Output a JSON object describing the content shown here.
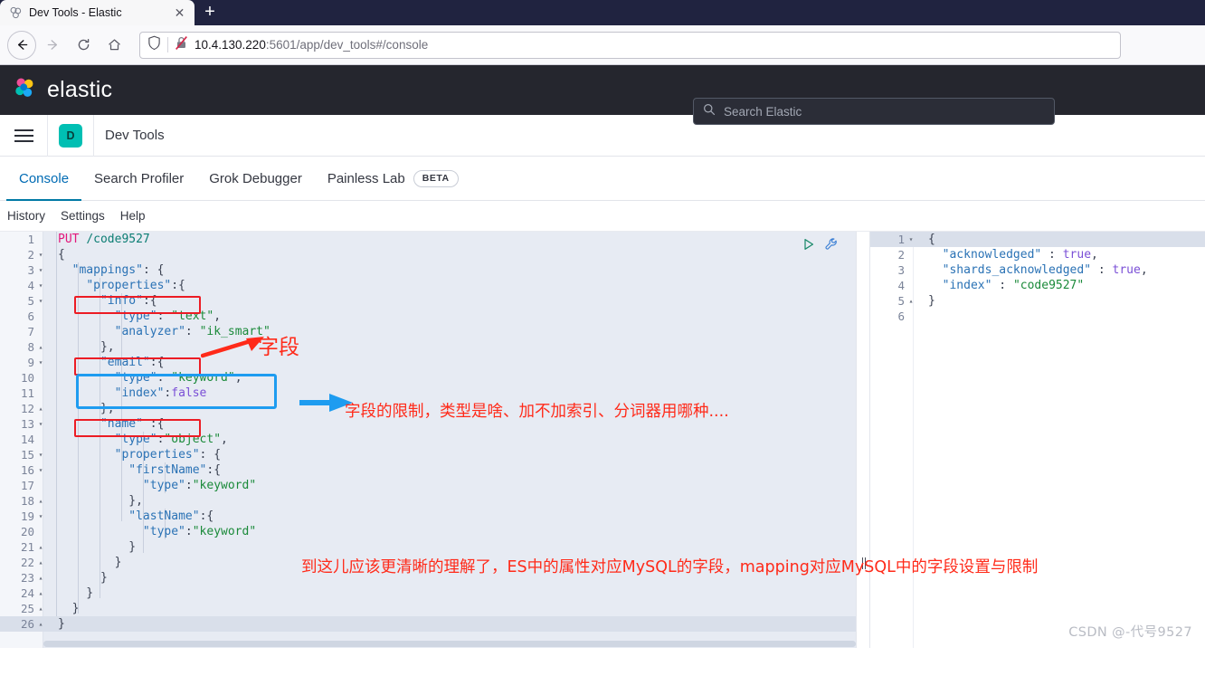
{
  "browser": {
    "tab": {
      "title": "Dev Tools - Elastic",
      "favicon_icon": "elastic-favicon",
      "close_icon": "close-icon"
    },
    "new_tab_label": "+",
    "nav": {
      "back_icon": "arrow-left-icon",
      "forward_icon": "arrow-right-icon",
      "reload_icon": "reload-icon",
      "home_icon": "home-icon"
    },
    "url": {
      "shield_icon": "shield-icon",
      "lock_icon": "lock-crossed-icon",
      "host": "10.4.130.220",
      "path": ":5601/app/dev_tools#/console",
      "full": "10.4.130.220:5601/app/dev_tools#/console"
    }
  },
  "elastic": {
    "logo_icon": "elastic-logo-icon",
    "brand": "elastic",
    "search": {
      "icon": "search-icon",
      "placeholder": "Search Elastic",
      "value": ""
    }
  },
  "appbar": {
    "menu_icon": "hamburger-menu-icon",
    "app_badge": "D",
    "app_title": "Dev Tools"
  },
  "tabs": [
    {
      "label": "Console",
      "active": true
    },
    {
      "label": "Search Profiler",
      "active": false
    },
    {
      "label": "Grok Debugger",
      "active": false
    },
    {
      "label": "Painless Lab",
      "active": false,
      "badge": "BETA"
    }
  ],
  "subnav": [
    "History",
    "Settings",
    "Help"
  ],
  "editor": {
    "play_icon": "play-request-icon",
    "wrench_icon": "wrench-icon",
    "lines": [
      {
        "n": 1,
        "fold": "",
        "tokens": [
          {
            "t": "PUT",
            "c": "t-method"
          },
          {
            "t": " ",
            "c": "t-punc"
          },
          {
            "t": "/code9527",
            "c": "t-url"
          }
        ]
      },
      {
        "n": 2,
        "fold": "▾",
        "tokens": [
          {
            "t": "{",
            "c": "t-punc"
          }
        ]
      },
      {
        "n": 3,
        "fold": "▾",
        "tokens": [
          {
            "t": "  ",
            "c": "t-punc"
          },
          {
            "t": "\"mappings\"",
            "c": "t-key"
          },
          {
            "t": ": {",
            "c": "t-punc"
          }
        ]
      },
      {
        "n": 4,
        "fold": "▾",
        "tokens": [
          {
            "t": "    ",
            "c": "t-punc"
          },
          {
            "t": "\"properties\"",
            "c": "t-key"
          },
          {
            "t": ":{",
            "c": "t-punc"
          }
        ]
      },
      {
        "n": 5,
        "fold": "▾",
        "tokens": [
          {
            "t": "      ",
            "c": "t-punc"
          },
          {
            "t": "\"info\"",
            "c": "t-key"
          },
          {
            "t": ":{",
            "c": "t-punc"
          }
        ]
      },
      {
        "n": 6,
        "fold": "",
        "tokens": [
          {
            "t": "        ",
            "c": "t-punc"
          },
          {
            "t": "\"type\"",
            "c": "t-key"
          },
          {
            "t": ": ",
            "c": "t-punc"
          },
          {
            "t": "\"text\"",
            "c": "t-str"
          },
          {
            "t": ",",
            "c": "t-punc"
          }
        ]
      },
      {
        "n": 7,
        "fold": "",
        "tokens": [
          {
            "t": "        ",
            "c": "t-punc"
          },
          {
            "t": "\"analyzer\"",
            "c": "t-key"
          },
          {
            "t": ": ",
            "c": "t-punc"
          },
          {
            "t": "\"ik_smart\"",
            "c": "t-str"
          }
        ]
      },
      {
        "n": 8,
        "fold": "▴",
        "tokens": [
          {
            "t": "      },",
            "c": "t-punc"
          }
        ]
      },
      {
        "n": 9,
        "fold": "▾",
        "tokens": [
          {
            "t": "      ",
            "c": "t-punc"
          },
          {
            "t": "\"email\"",
            "c": "t-key"
          },
          {
            "t": ":{",
            "c": "t-punc"
          }
        ]
      },
      {
        "n": 10,
        "fold": "",
        "tokens": [
          {
            "t": "        ",
            "c": "t-punc"
          },
          {
            "t": "\"type\"",
            "c": "t-key"
          },
          {
            "t": ": ",
            "c": "t-punc"
          },
          {
            "t": "\"keyword\"",
            "c": "t-str"
          },
          {
            "t": ",",
            "c": "t-punc"
          }
        ]
      },
      {
        "n": 11,
        "fold": "",
        "tokens": [
          {
            "t": "        ",
            "c": "t-punc"
          },
          {
            "t": "\"index\"",
            "c": "t-key"
          },
          {
            "t": ":",
            "c": "t-punc"
          },
          {
            "t": "false",
            "c": "t-bool"
          }
        ]
      },
      {
        "n": 12,
        "fold": "▴",
        "tokens": [
          {
            "t": "      },",
            "c": "t-punc"
          }
        ]
      },
      {
        "n": 13,
        "fold": "▾",
        "tokens": [
          {
            "t": "      ",
            "c": "t-punc"
          },
          {
            "t": "\"name\"",
            "c": "t-key"
          },
          {
            "t": " :{",
            "c": "t-punc"
          }
        ]
      },
      {
        "n": 14,
        "fold": "",
        "tokens": [
          {
            "t": "        ",
            "c": "t-punc"
          },
          {
            "t": "\"type\"",
            "c": "t-key"
          },
          {
            "t": ":",
            "c": "t-punc"
          },
          {
            "t": "\"object\"",
            "c": "t-str"
          },
          {
            "t": ",",
            "c": "t-punc"
          }
        ]
      },
      {
        "n": 15,
        "fold": "▾",
        "tokens": [
          {
            "t": "        ",
            "c": "t-punc"
          },
          {
            "t": "\"properties\"",
            "c": "t-key"
          },
          {
            "t": ": {",
            "c": "t-punc"
          }
        ]
      },
      {
        "n": 16,
        "fold": "▾",
        "tokens": [
          {
            "t": "          ",
            "c": "t-punc"
          },
          {
            "t": "\"firstName\"",
            "c": "t-key"
          },
          {
            "t": ":{",
            "c": "t-punc"
          }
        ]
      },
      {
        "n": 17,
        "fold": "",
        "tokens": [
          {
            "t": "            ",
            "c": "t-punc"
          },
          {
            "t": "\"type\"",
            "c": "t-key"
          },
          {
            "t": ":",
            "c": "t-punc"
          },
          {
            "t": "\"keyword\"",
            "c": "t-str"
          }
        ]
      },
      {
        "n": 18,
        "fold": "▴",
        "tokens": [
          {
            "t": "          },",
            "c": "t-punc"
          }
        ]
      },
      {
        "n": 19,
        "fold": "▾",
        "tokens": [
          {
            "t": "          ",
            "c": "t-punc"
          },
          {
            "t": "\"lastName\"",
            "c": "t-key"
          },
          {
            "t": ":{",
            "c": "t-punc"
          }
        ]
      },
      {
        "n": 20,
        "fold": "",
        "tokens": [
          {
            "t": "            ",
            "c": "t-punc"
          },
          {
            "t": "\"type\"",
            "c": "t-key"
          },
          {
            "t": ":",
            "c": "t-punc"
          },
          {
            "t": "\"keyword\"",
            "c": "t-str"
          }
        ]
      },
      {
        "n": 21,
        "fold": "▴",
        "tokens": [
          {
            "t": "          }",
            "c": "t-punc"
          }
        ]
      },
      {
        "n": 22,
        "fold": "▴",
        "tokens": [
          {
            "t": "        }",
            "c": "t-punc"
          }
        ]
      },
      {
        "n": 23,
        "fold": "▴",
        "tokens": [
          {
            "t": "      }",
            "c": "t-punc"
          }
        ]
      },
      {
        "n": 24,
        "fold": "▴",
        "tokens": [
          {
            "t": "    }",
            "c": "t-punc"
          }
        ]
      },
      {
        "n": 25,
        "fold": "▴",
        "tokens": [
          {
            "t": "  }",
            "c": "t-punc"
          }
        ]
      },
      {
        "n": 26,
        "fold": "▴",
        "tokens": [
          {
            "t": "}",
            "c": "t-punc"
          }
        ],
        "highlight": true
      }
    ]
  },
  "response": {
    "lines": [
      {
        "n": 1,
        "fold": "▾",
        "tokens": [
          {
            "t": "{",
            "c": "t-punc"
          }
        ],
        "highlight": true
      },
      {
        "n": 2,
        "fold": "",
        "tokens": [
          {
            "t": "  ",
            "c": "t-punc"
          },
          {
            "t": "\"acknowledged\"",
            "c": "t-key"
          },
          {
            "t": " : ",
            "c": "t-punc"
          },
          {
            "t": "true",
            "c": "t-bool"
          },
          {
            "t": ",",
            "c": "t-punc"
          }
        ]
      },
      {
        "n": 3,
        "fold": "",
        "tokens": [
          {
            "t": "  ",
            "c": "t-punc"
          },
          {
            "t": "\"shards_acknowledged\"",
            "c": "t-key"
          },
          {
            "t": " : ",
            "c": "t-punc"
          },
          {
            "t": "true",
            "c": "t-bool"
          },
          {
            "t": ",",
            "c": "t-punc"
          }
        ]
      },
      {
        "n": 4,
        "fold": "",
        "tokens": [
          {
            "t": "  ",
            "c": "t-punc"
          },
          {
            "t": "\"index\"",
            "c": "t-key"
          },
          {
            "t": " : ",
            "c": "t-punc"
          },
          {
            "t": "\"code9527\"",
            "c": "t-str"
          }
        ]
      },
      {
        "n": 5,
        "fold": "▴",
        "tokens": [
          {
            "t": "}",
            "c": "t-punc"
          }
        ]
      },
      {
        "n": 6,
        "fold": "",
        "tokens": [
          {
            "t": "",
            "c": "t-punc"
          }
        ]
      }
    ]
  },
  "annotations": {
    "field_label": "字段",
    "blue_note": "字段的限制，类型是啥、加不加索引、分词器用哪种....",
    "bottom_note": "到这儿应该更清晰的理解了，ES中的属性对应MySQL的字段，mapping对应MySQL中的字段设置与限制",
    "red_arrow_icon": "red-arrow-icon",
    "blue_arrow_icon": "blue-arrow-icon",
    "box_colors": {
      "red": "#ec1c24",
      "blue": "#1e9cf0",
      "text_red": "#ff2a19"
    }
  },
  "watermark": "CSDN @-代号9527"
}
